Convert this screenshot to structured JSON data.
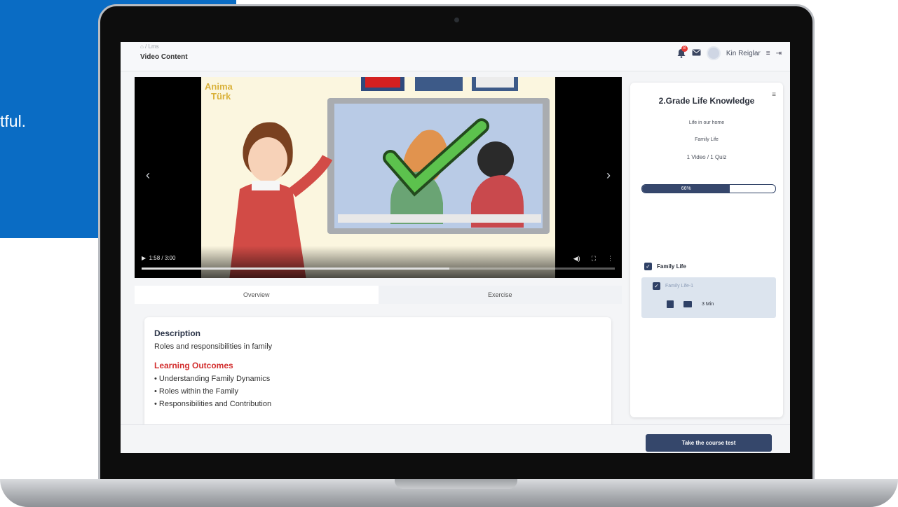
{
  "marketing": {
    "text": "tful."
  },
  "header": {
    "breadcrumb": "⌂ / Lms",
    "page_title": "Video Content",
    "notification_count": "8",
    "user_name": "Kin Reiglar"
  },
  "video": {
    "time": "1:58 / 3:00",
    "progress_fraction": 0.65,
    "logo_line1": "Anima",
    "logo_line2": "Türk"
  },
  "tabs": [
    "Overview",
    "Exercise"
  ],
  "description": {
    "heading": "Description",
    "text": "Roles and responsibilities in family",
    "outcomes_heading": "Learning Outcomes",
    "outcomes": [
      "• Understanding Family Dynamics",
      "• Roles within the Family",
      "• Responsibilities and Contribution"
    ]
  },
  "course": {
    "title": "2.Grade Life Knowledge",
    "unit": "Life in our home",
    "topic": "Family Life",
    "counts": "1 Video / 1 Quiz",
    "progress_label": "66%",
    "progress_fraction": 0.66,
    "section": "Family Life",
    "item": "Family Life-1",
    "duration": "3 Min",
    "test_button": "Take the course test"
  },
  "colors": {
    "accent": "#35476b",
    "brand_blue": "#0a6cc4",
    "outcome_red": "#d32f2f"
  }
}
